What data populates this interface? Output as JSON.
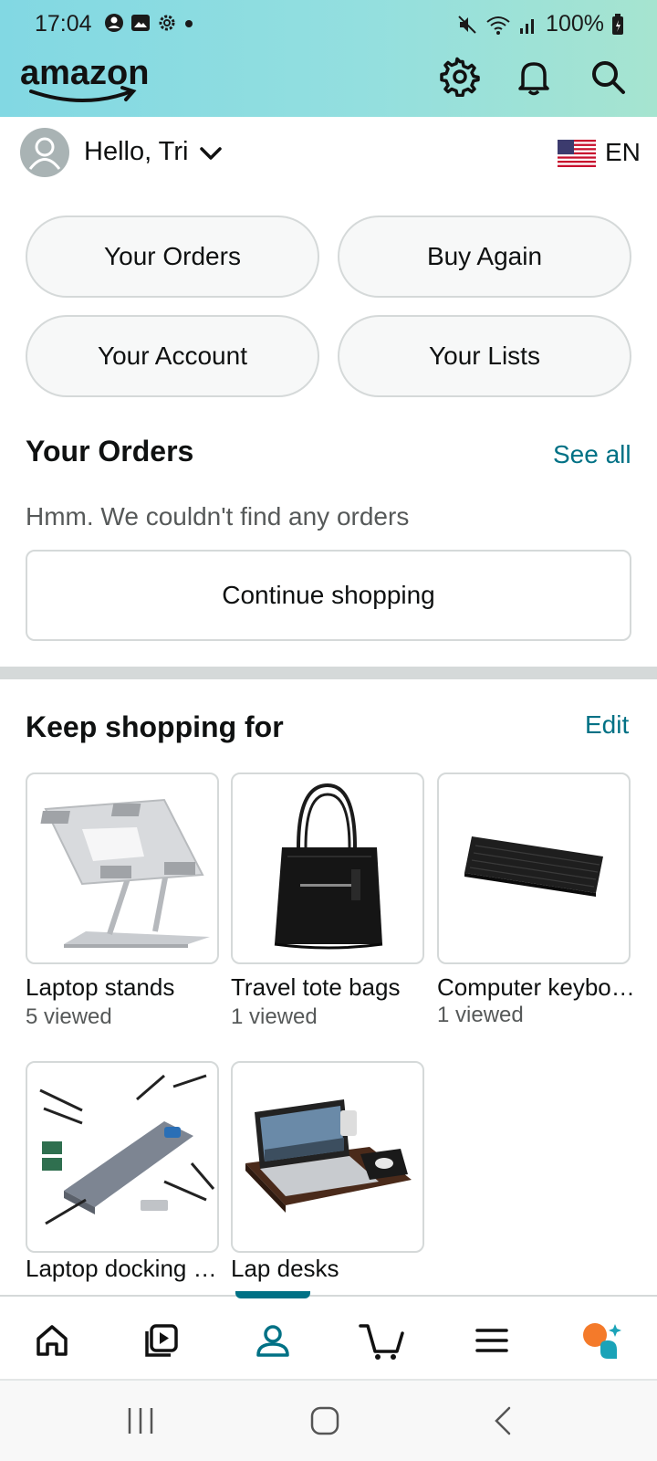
{
  "status_bar": {
    "time": "17:04",
    "battery": "100%"
  },
  "header": {
    "logo_text": "amazon",
    "icons": [
      "gear-icon",
      "bell-icon",
      "search-icon"
    ]
  },
  "account": {
    "greeting": "Hello, Tri",
    "language": "EN"
  },
  "quick_actions": [
    {
      "label": "Your Orders"
    },
    {
      "label": "Buy Again"
    },
    {
      "label": "Your Account"
    },
    {
      "label": "Your Lists"
    }
  ],
  "orders": {
    "title": "Your Orders",
    "see_all": "See all",
    "empty_message": "Hmm. We couldn't find any orders",
    "continue_button": "Continue shopping"
  },
  "keep_shopping": {
    "title": "Keep shopping for",
    "edit": "Edit",
    "items": [
      {
        "label": "Laptop stands",
        "sub": "5 viewed",
        "image": "laptop-stand"
      },
      {
        "label": "Travel tote bags",
        "sub": "1 viewed",
        "image": "tote-bag"
      },
      {
        "label": "Computer keyboards",
        "sub": "1 viewed",
        "image": "keyboard"
      },
      {
        "label": "Laptop docking stations",
        "sub": "",
        "image": "docking-station"
      },
      {
        "label": "Lap desks",
        "sub": "",
        "image": "lap-desk"
      }
    ]
  },
  "bottom_nav": {
    "items": [
      "home-icon",
      "video-icon",
      "account-icon",
      "cart-icon",
      "menu-icon",
      "rufus-icon"
    ],
    "active": "account-icon"
  },
  "colors": {
    "accent_teal": "#007185",
    "header_gradient_start": "#82d8e3",
    "header_gradient_end": "#a6e4d0",
    "border": "#d5d9d9",
    "rufus_orange": "#f47a2a"
  }
}
